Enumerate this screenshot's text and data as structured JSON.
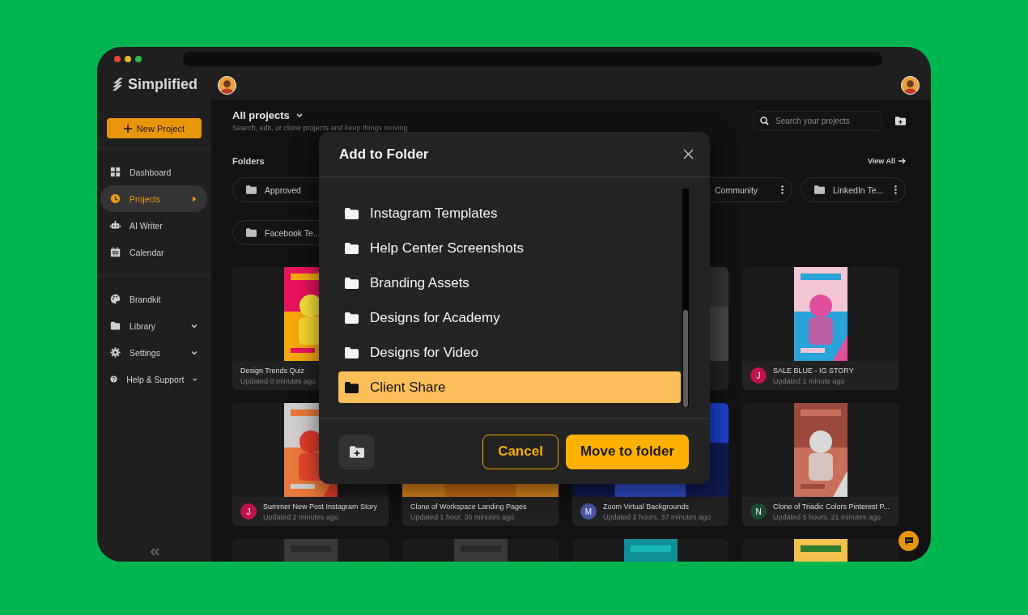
{
  "sidebar": {
    "logo": "Simplified",
    "new_project": "New Project",
    "groups": [
      [
        {
          "label": "Dashboard",
          "selected": false,
          "expandable": false
        },
        {
          "label": "Projects",
          "selected": true,
          "expandable": false
        },
        {
          "label": "AI Writer",
          "selected": false,
          "expandable": false
        },
        {
          "label": "Calendar",
          "selected": false,
          "expandable": false
        }
      ],
      [
        {
          "label": "Brandkit",
          "selected": false,
          "expandable": false
        },
        {
          "label": "Library",
          "selected": false,
          "expandable": true
        },
        {
          "label": "Settings",
          "selected": false,
          "expandable": true
        },
        {
          "label": "Help & Support",
          "selected": false,
          "expandable": true
        }
      ]
    ]
  },
  "header": {
    "title": "All projects",
    "subtitle": "Search, edit, or clone projects and keep things moving",
    "search": {
      "placeholder": "Search your projects"
    }
  },
  "folders": {
    "title": "Folders",
    "view_all": "View All",
    "chips": [
      {
        "label": "Approved",
        "menu": false
      },
      {
        "label": "Community",
        "menu": true
      },
      {
        "label": "LinkedIn Te...",
        "menu": true
      },
      {
        "label": "Facebook Te...",
        "menu": false
      }
    ]
  },
  "projects": [
    {
      "kind": "project",
      "title": "Design Trends Quiz",
      "updated": "Updated 0 minutes ago"
    },
    {
      "kind": "picture"
    },
    {
      "kind": "project",
      "title": "SALE BLUE - IG STORY",
      "updated": "Updated 1 minute ago",
      "avatar": "J",
      "color": "#c0134a"
    },
    {
      "kind": "project",
      "title": "Summer New Post Instagram Story",
      "updated": "Updated 2 minutes ago",
      "avatar": "J",
      "color": "#c0134a"
    },
    {
      "kind": "project",
      "title": "Clone of Workspace Landing Pages",
      "updated": "Updated 1 hour, 36 minutes ago"
    },
    {
      "kind": "project",
      "title": "Zoom Virtual Backgrounds",
      "updated": "Updated 2 hours, 37 minutes ago",
      "avatar": "M",
      "color": "#4a58a6"
    },
    {
      "kind": "project",
      "title": "Clone of Triadic Colors Pinterest P...",
      "updated": "Updated 5 hours, 21 minutes ago",
      "avatar": "N",
      "color": "#1c4a34"
    },
    {
      "kind": "picture"
    },
    {
      "kind": "picture"
    },
    {
      "kind": "picture"
    },
    {
      "kind": "picture"
    }
  ],
  "dialog": {
    "title": "Add to Folder",
    "items": [
      {
        "label": "Instagram Templates",
        "selected": false
      },
      {
        "label": "Help Center Screenshots",
        "selected": false
      },
      {
        "label": "Branding Assets",
        "selected": false
      },
      {
        "label": "Designs for Academy",
        "selected": false
      },
      {
        "label": "Designs for Video",
        "selected": false
      },
      {
        "label": "Client Share",
        "selected": true
      }
    ],
    "cancel": "Cancel",
    "confirm": "Move to folder"
  }
}
